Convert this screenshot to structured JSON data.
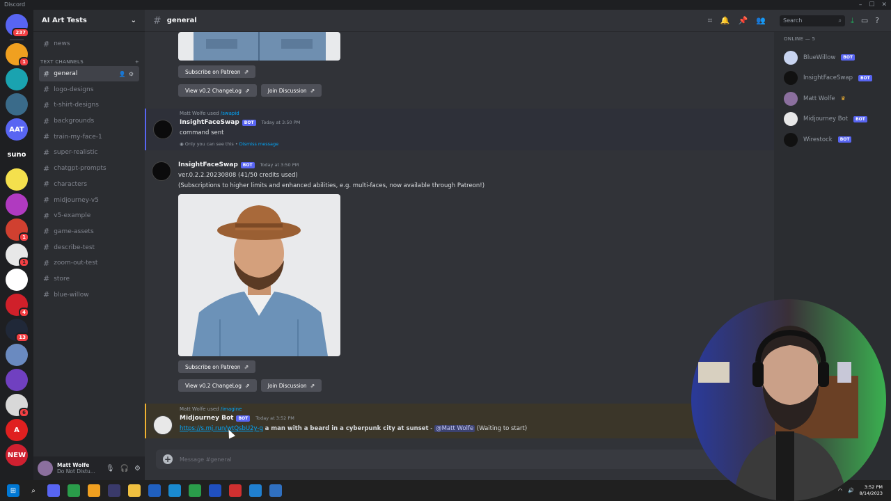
{
  "window": {
    "title": "Discord",
    "controls": [
      "–",
      "☐",
      "✕"
    ]
  },
  "guilds": [
    {
      "icon": "discord-home-icon",
      "color": "#5865f2",
      "label": "",
      "badge": "237"
    },
    {
      "icon": "server-icon",
      "color": "#f0a020",
      "label": "",
      "badge": "1"
    },
    {
      "icon": "server-icon",
      "color": "#1aa3b0",
      "label": "",
      "badge": ""
    },
    {
      "icon": "server-icon",
      "color": "#3a6b8a",
      "label": "",
      "badge": ""
    },
    {
      "icon": "server-icon",
      "color": "#5865f2",
      "label": "AAT",
      "badge": ""
    },
    {
      "icon": "server-icon",
      "color": "#1e1f22",
      "label": "suno",
      "badge": ""
    },
    {
      "icon": "server-icon",
      "color": "#f4e04d",
      "label": "",
      "badge": ""
    },
    {
      "icon": "server-icon",
      "color": "#b03ac0",
      "label": "",
      "badge": ""
    },
    {
      "icon": "server-icon",
      "color": "#d04030",
      "label": "",
      "badge": "1"
    },
    {
      "icon": "server-icon",
      "color": "#e8e8e8",
      "label": "",
      "badge": "1"
    },
    {
      "icon": "server-icon",
      "color": "#ffffff",
      "label": "",
      "badge": ""
    },
    {
      "icon": "server-icon",
      "color": "#d0202a",
      "label": "",
      "badge": "4"
    },
    {
      "icon": "server-icon",
      "color": "#202838",
      "label": "",
      "badge": "13"
    },
    {
      "icon": "server-icon",
      "color": "#6a8ac0",
      "label": "",
      "badge": ""
    },
    {
      "icon": "server-icon",
      "color": "#7040c0",
      "label": "",
      "badge": ""
    },
    {
      "icon": "server-icon",
      "color": "#d8d8d8",
      "label": "",
      "badge": "6"
    },
    {
      "icon": "server-icon",
      "color": "#e02020",
      "label": "A",
      "badge": ""
    },
    {
      "icon": "server-icon",
      "color": "#d02030",
      "label": "NEW",
      "badge": ""
    }
  ],
  "server": {
    "name": "AI Art Tests",
    "category": "TEXT CHANNELS",
    "top_channels": [
      "news"
    ],
    "channels": [
      "general",
      "logo-designs",
      "t-shirt-designs",
      "backgrounds",
      "train-my-face-1",
      "super-realistic",
      "chatgpt-prompts",
      "characters",
      "midjourney-v5",
      "v5-example",
      "game-assets",
      "describe-test",
      "zoom-out-test",
      "store",
      "blue-willow"
    ],
    "active_channel": "general"
  },
  "user": {
    "name": "Matt Wolfe",
    "status": "Do Not Distu..."
  },
  "topbar": {
    "channel": "general",
    "search_placeholder": "Search"
  },
  "buttons": {
    "subscribe": "Subscribe on Patreon",
    "changelog": "View v0.2 ChangeLog",
    "discussion": "Join Discussion"
  },
  "messages": {
    "m1": {
      "used_by": "Matt Wolfe used",
      "command": "/swapid",
      "author": "InsightFaceSwap",
      "tag": "BOT",
      "time": "Today at 3:50 PM",
      "text": "command sent",
      "ephemeral": "Only you can see this •",
      "dismiss": "Dismiss message"
    },
    "m2": {
      "author": "InsightFaceSwap",
      "tag": "BOT",
      "time": "Today at 3:50 PM",
      "line1": "ver.0.2.2.20230808 (41/50 credits used)",
      "line2": "(Subscriptions to higher limits and enhanced abilities, e.g. multi-faces, now available through Patreon!)"
    },
    "m3": {
      "used_by": "Matt Wolfe used",
      "command": "/imagine",
      "author": "Midjourney Bot",
      "tag": "BOT",
      "time": "Today at 3:52 PM",
      "link": "https://s.mj.run/wtQsbU2y-g",
      "prompt": "a man with a beard in a cyberpunk city at sunset",
      "sep": " - ",
      "mention": "@Matt Wolfe",
      "status": "(Waiting to start)"
    }
  },
  "composer": {
    "placeholder": "Message #general"
  },
  "members": {
    "header": "ONLINE — 5",
    "list": [
      {
        "name": "BlueWillow",
        "tag": "BOT",
        "color": "#c8d4f0"
      },
      {
        "name": "InsightFaceSwap",
        "tag": "BOT",
        "color": "#111111"
      },
      {
        "name": "Matt Wolfe",
        "tag": "",
        "color": "#8b6f9e"
      },
      {
        "name": "Midjourney Bot",
        "tag": "BOT",
        "color": "#e8e8e8"
      },
      {
        "name": "Wirestock",
        "tag": "BOT",
        "color": "#111111"
      }
    ]
  },
  "taskbar": {
    "apps": [
      "windows-start-icon",
      "search-icon",
      "discord-icon",
      "chrome-icon",
      "files-icon",
      "obs-icon",
      "explorer-icon",
      "app-icon",
      "edge-icon",
      "chrome-icon",
      "app-icon",
      "app-icon",
      "store-icon",
      "app-icon"
    ],
    "time": "3:52 PM",
    "date": "8/14/2023"
  },
  "colors": {
    "accent": "#5865f2",
    "link": "#00a8fc",
    "mention_bg": "#3c4270",
    "background": "#313338"
  }
}
